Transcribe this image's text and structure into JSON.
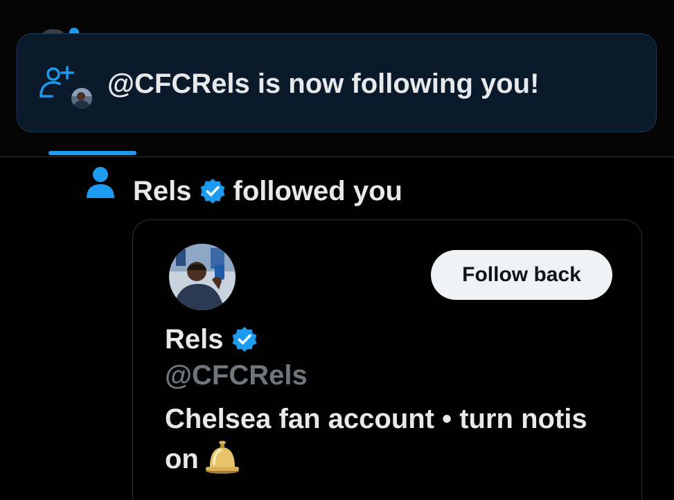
{
  "toast": {
    "message": "@CFCRels is now following you!",
    "icon": "user-plus-icon"
  },
  "notification": {
    "icon": "person-icon",
    "name": "Rels",
    "action": "followed you",
    "verified_icon": "verified-badge-icon"
  },
  "card": {
    "name": "Rels",
    "handle": "@CFCRels",
    "bio": "Chelsea fan account • turn notis on",
    "bio_emoji": "bell-icon",
    "follow_back_label": "Follow back"
  },
  "colors": {
    "background": "#000000",
    "accent": "#1d9bf0",
    "toast_bg": "#0b1a2a",
    "toast_border": "#1e3a56",
    "button_bg": "#eff3f4",
    "handle_gray": "#71767b",
    "text": "#e7e9ea"
  }
}
